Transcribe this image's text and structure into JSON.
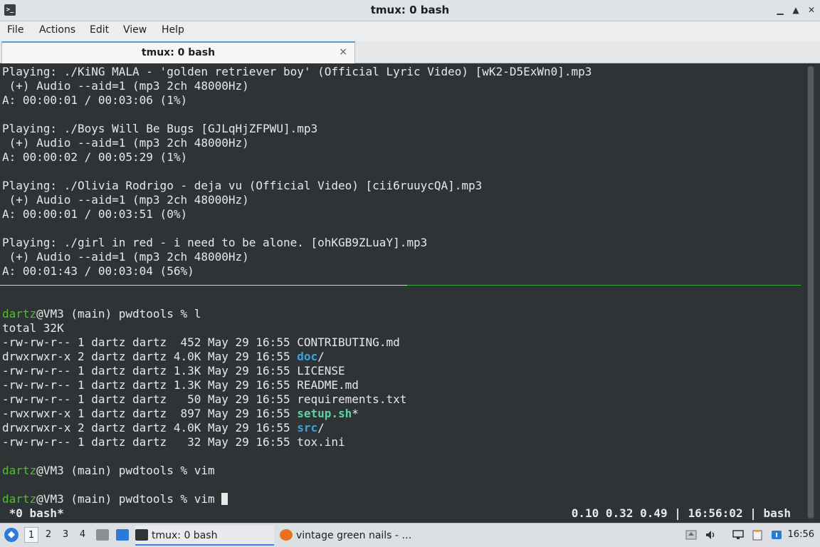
{
  "window": {
    "title": "tmux: 0 bash",
    "app_icon_glyph": ">_",
    "controls": [
      "▁",
      "▲",
      "✕"
    ]
  },
  "menubar": {
    "items": [
      "File",
      "Actions",
      "Edit",
      "View",
      "Help"
    ]
  },
  "tabs": [
    {
      "label": "tmux: 0 bash",
      "close": "×"
    }
  ],
  "terminal": {
    "top_pane": [
      "Playing: ./KiNG MALA - 'golden retriever boy' (Official Lyric Video) [wK2-D5ExWn0].mp3",
      " (+) Audio --aid=1 (mp3 2ch 48000Hz)",
      "A: 00:00:01 / 00:03:06 (1%)",
      "",
      "Playing: ./Boys Will Be Bugs [GJLqHjZFPWU].mp3",
      " (+) Audio --aid=1 (mp3 2ch 48000Hz)",
      "A: 00:00:02 / 00:05:29 (1%)",
      "",
      "Playing: ./Olivia Rodrigo - deja vu (Official Video) [cii6ruuycQA].mp3",
      " (+) Audio --aid=1 (mp3 2ch 48000Hz)",
      "A: 00:00:01 / 00:03:51 (0%)",
      "",
      "Playing: ./girl in red - i need to be alone. [ohKGB9ZLuaY].mp3",
      " (+) Audio --aid=1 (mp3 2ch 48000Hz)",
      "A: 00:01:43 / 00:03:04 (56%)"
    ],
    "prompt": {
      "user": "dartz",
      "rest": "@VM3 (main) pwdtools % "
    },
    "commands": [
      "l",
      "vim",
      "vim"
    ],
    "total": "total 32K",
    "listing": [
      {
        "meta": "-rw-rw-r-- 1 dartz dartz  452 May 29 16:55 ",
        "name": "CONTRIBUTING.md",
        "kind": "file",
        "suffix": ""
      },
      {
        "meta": "drwxrwxr-x 2 dartz dartz 4.0K May 29 16:55 ",
        "name": "doc",
        "kind": "dir",
        "suffix": "/"
      },
      {
        "meta": "-rw-rw-r-- 1 dartz dartz 1.3K May 29 16:55 ",
        "name": "LICENSE",
        "kind": "file",
        "suffix": ""
      },
      {
        "meta": "-rw-rw-r-- 1 dartz dartz 1.3K May 29 16:55 ",
        "name": "README.md",
        "kind": "file",
        "suffix": ""
      },
      {
        "meta": "-rw-rw-r-- 1 dartz dartz   50 May 29 16:55 ",
        "name": "requirements.txt",
        "kind": "file",
        "suffix": ""
      },
      {
        "meta": "-rwxrwxr-x 1 dartz dartz  897 May 29 16:55 ",
        "name": "setup.sh",
        "kind": "exec",
        "suffix": "*"
      },
      {
        "meta": "drwxrwxr-x 2 dartz dartz 4.0K May 29 16:55 ",
        "name": "src",
        "kind": "dir",
        "suffix": "/"
      },
      {
        "meta": "-rw-rw-r-- 1 dartz dartz   32 May 29 16:55 ",
        "name": "tox.ini",
        "kind": "file",
        "suffix": ""
      }
    ],
    "status_left": " *0 bash*",
    "status_right": "0.10 0.32 0.49 | 16:56:02 | bash",
    "colors": {
      "background": "#2e3436",
      "prompt_user": "#4fbf2a",
      "dir": "#3aa3e0",
      "exec": "#5fd3a0",
      "active_pane_border": "#3da83a"
    }
  },
  "taskbar": {
    "start_icon": "start-menu-icon",
    "workspaces": [
      "1",
      "2",
      "3",
      "4"
    ],
    "active_workspace": "1",
    "tasks": [
      {
        "label": "tmux: 0 bash",
        "icon": "terminal-icon"
      },
      {
        "label": "vintage green nails - …",
        "icon": "firefox-icon"
      }
    ],
    "clock": "16:56"
  }
}
